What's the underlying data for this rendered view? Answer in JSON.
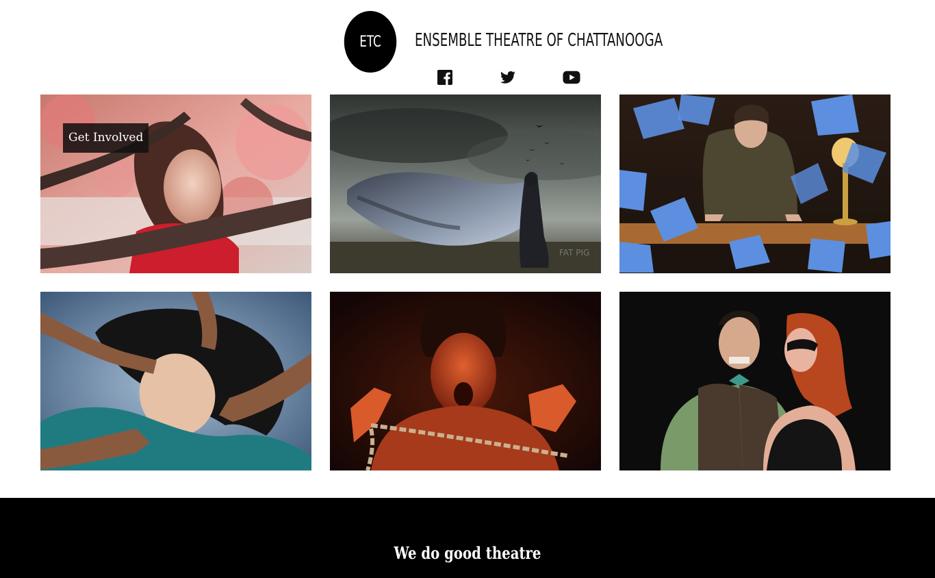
{
  "header": {
    "logo_text": "ETC",
    "site_title": "ENSEMBLE THEATRE OF CHATTANOOGA",
    "social": [
      {
        "icon": "facebook-icon"
      },
      {
        "icon": "twitter-icon"
      },
      {
        "icon": "youtube-icon"
      }
    ]
  },
  "gallery": {
    "tiles": [
      {
        "overlay_label": "Get Involved"
      },
      {
        "watermark": "FAT PIG"
      },
      {},
      {},
      {},
      {}
    ]
  },
  "footer": {
    "tagline": "We do good theatre"
  },
  "colors": {
    "background": "#ffffff",
    "footer_background": "#000000",
    "logo_background": "#000000"
  }
}
